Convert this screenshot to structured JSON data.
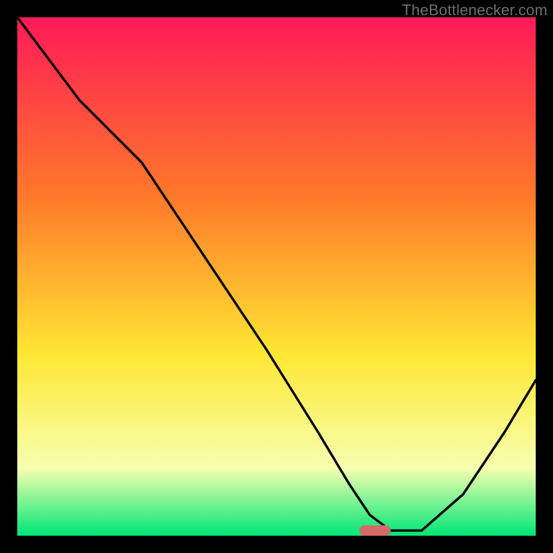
{
  "watermark": "TheBottlenecker.com",
  "chart_data": {
    "type": "line",
    "title": "",
    "xlabel": "",
    "ylabel": "",
    "xlim": [
      0,
      100
    ],
    "ylim": [
      0,
      100
    ],
    "background_gradient": {
      "top_color": "#ff1a58",
      "mid_upper": "#ff7a2a",
      "mid_lower": "#ffe733",
      "lower": "#f6ffb0",
      "bottom_color": "#00e676"
    },
    "series": [
      {
        "name": "bottleneck-curve",
        "color": "#000000",
        "x": [
          0,
          12,
          24,
          36,
          48,
          58,
          64,
          68,
          72,
          78,
          86,
          94,
          100
        ],
        "values": [
          100,
          84,
          72,
          54,
          36,
          20,
          10,
          4,
          1,
          1,
          8,
          20,
          30
        ]
      }
    ],
    "marker": {
      "name": "target-marker",
      "color": "#d46a6a",
      "x": 69,
      "y": 1,
      "width": 6,
      "height": 2
    }
  }
}
